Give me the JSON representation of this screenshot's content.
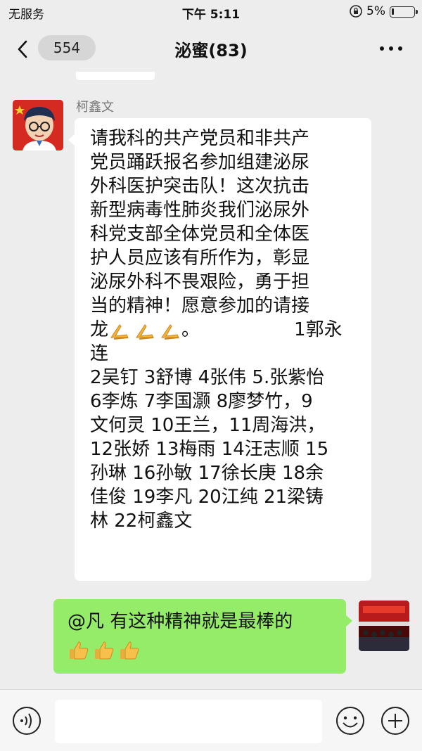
{
  "status_bar": {
    "carrier": "无服务",
    "time": "下午 5:11",
    "battery_percent": "5%"
  },
  "header": {
    "back_count": "554",
    "title": "泌蜜(83)"
  },
  "messages": [
    {
      "sender": "柯鑫文",
      "side": "left",
      "lines": [
        "请我科的共产党员和非共产",
        "党员踊跃报名参加组建泌尿",
        "外科医护突击队！这次抗击",
        "新型病毒性肺炎我们泌尿外",
        "科党支部全体党员和全体医",
        "护人员应该有所作为，彰显",
        "泌尿外科不畏艰险，勇于担",
        "当的精神！愿意参加的请接",
        "龙",
        "连",
        "2吴钉 3舒博 4张伟 5.张紫怡",
        "6李炼 7李国灏 8廖梦竹，9",
        "文何灵 10王兰，11周海洪，",
        "12张娇 13梅雨 14汪志顺 15",
        "孙琳 16孙敏 17徐长庚 18余",
        "佳俊 19李凡 20江纯 21梁铸",
        "林 22柯鑫文"
      ],
      "line9_suffix": "。",
      "line9_tail": "1郭永",
      "line9_emoji": "folded-hands",
      "line9_emoji_count": 3
    },
    {
      "side": "right",
      "text": "@凡 有这种精神就是最棒的",
      "emoji": "thumbs-up",
      "emoji_count": 3
    }
  ],
  "colors": {
    "background": "#ededed",
    "bubble_left": "#ffffff",
    "bubble_right": "#95ec69",
    "avatar_left_bg": "#d42a22"
  },
  "icons": [
    "back-chevron-icon",
    "more-icon",
    "voice-icon",
    "emoji-icon",
    "plus-icon"
  ]
}
